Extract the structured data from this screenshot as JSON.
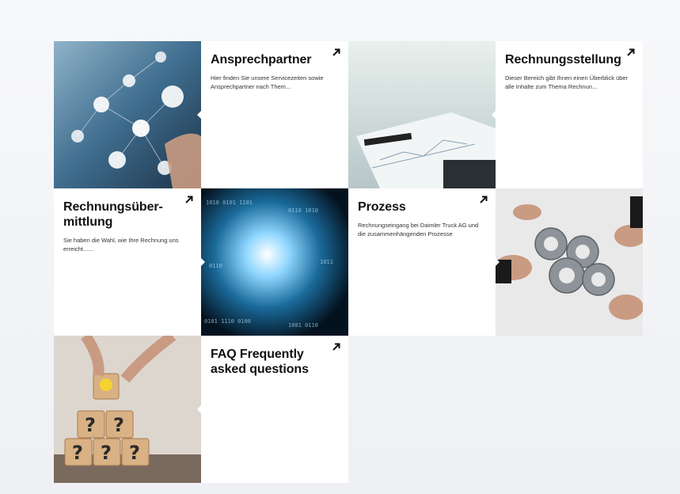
{
  "tiles": [
    {
      "title": "Ansprechpartner",
      "desc": "Hier finden Sie unsere Servicezeiten sowie Ansprechpartner nach Them...",
      "icon": "arrow-up-right-icon"
    },
    {
      "title": "Rechnungsstellung",
      "desc": "Dieser Bereich gibt Ihnen einen Überblick über alle Inhalte zum Thema Rechnun...",
      "icon": "arrow-up-right-icon"
    },
    {
      "title": "Rechnungsüber-mittlung",
      "desc": "Sie haben die Wahl, wie Ihre Rechnung uns erreicht......",
      "icon": "arrow-up-right-icon"
    },
    {
      "title": "Prozess",
      "desc": "Rechnungseingang bei Daimler Truck AG und die zusammenhängenden Prozesse",
      "icon": "arrow-up-right-icon"
    },
    {
      "title": "FAQ Frequently asked questions",
      "desc": "",
      "icon": "arrow-up-right-icon"
    }
  ],
  "images": [
    {
      "name": "network-people-image"
    },
    {
      "name": "financial-chart-image"
    },
    {
      "name": "binary-tunnel-image"
    },
    {
      "name": "gears-hands-image"
    },
    {
      "name": "question-blocks-image"
    }
  ],
  "colors": {
    "tile_bg": "#ffffff",
    "title": "#111111",
    "page_bg": "#f3f4f6"
  }
}
